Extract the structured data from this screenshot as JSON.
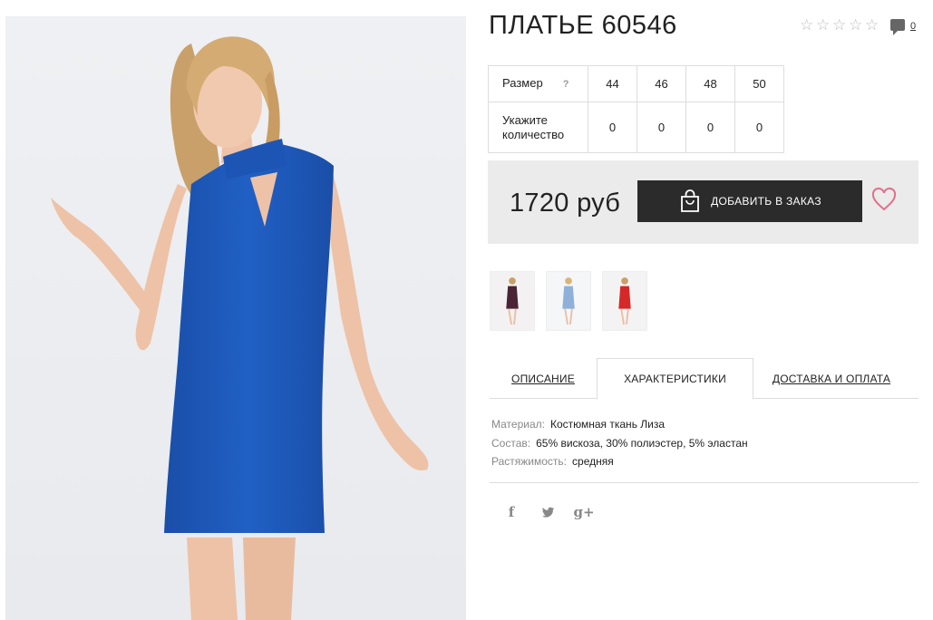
{
  "product": {
    "title": "ПЛАТЬЕ 60546",
    "rating_stars": 5,
    "rating_value": 0,
    "comments_count": "0"
  },
  "sizes": {
    "label": "Размер",
    "help": "?",
    "qty_label_1": "Укажите",
    "qty_label_2": "количество",
    "values": [
      "44",
      "46",
      "48",
      "50"
    ],
    "quantities": [
      "0",
      "0",
      "0",
      "0"
    ]
  },
  "purchase": {
    "price": "1720 руб",
    "order_button": "ДОБАВИТЬ В ЗАКАЗ"
  },
  "variants": [
    {
      "color": "#4a2434",
      "name": "bordeaux"
    },
    {
      "color": "#8fb0d8",
      "name": "light-blue"
    },
    {
      "color": "#d62828",
      "name": "red"
    }
  ],
  "tabs": [
    {
      "label": "ОПИСАНИЕ",
      "active": false
    },
    {
      "label": "ХАРАКТЕРИСТИКИ",
      "active": true
    },
    {
      "label": "ДОСТАВКА И ОПЛАТА",
      "active": false
    }
  ],
  "specs": [
    {
      "key": "Материал:",
      "value": "Костюмная ткань Лиза"
    },
    {
      "key": "Состав:",
      "value": "65% вискоза, 30% полиэстер, 5% эластан"
    },
    {
      "key": "Растяжимость:",
      "value": "средняя"
    }
  ],
  "social": {
    "facebook": "f",
    "twitter": "twitter-icon",
    "googleplus": "g+"
  },
  "colors": {
    "dress_blue": "#1f58b8",
    "button_dark": "#2b2b2b",
    "heart_pink": "#e0708c",
    "price_bg": "#ebebeb"
  }
}
